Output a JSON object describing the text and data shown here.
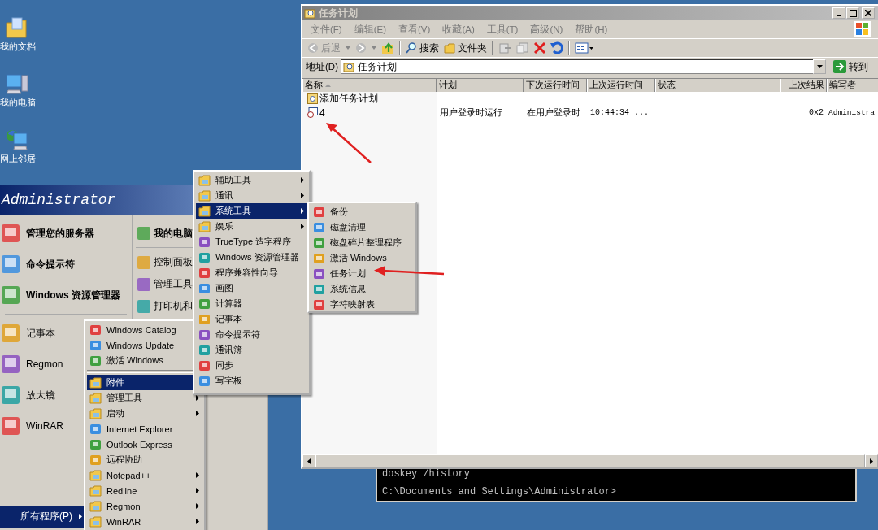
{
  "desktop_icons": [
    {
      "label": "我的文档",
      "kind": "documents"
    },
    {
      "label": "我的电脑",
      "kind": "computer"
    },
    {
      "label": "网上邻居",
      "kind": "network"
    }
  ],
  "explorer": {
    "title": "任务计划",
    "menu": [
      "文件(F)",
      "编辑(E)",
      "查看(V)",
      "收藏(A)",
      "工具(T)",
      "高级(N)",
      "帮助(H)"
    ],
    "toolbar": {
      "back": "后退",
      "search": "搜索",
      "folders": "文件夹"
    },
    "address": {
      "label": "地址(D)",
      "value": "任务计划",
      "go": "转到"
    },
    "columns": [
      {
        "label": "名称",
        "sorted": true
      },
      {
        "label": "计划",
        "sorted": false
      },
      {
        "label": "下次运行时间",
        "sorted": false
      },
      {
        "label": "上次运行时间",
        "sorted": false
      },
      {
        "label": "状态",
        "sorted": false
      },
      {
        "label": "上次结果",
        "sorted": false
      },
      {
        "label": "编写者",
        "sorted": false
      }
    ],
    "rows": [
      {
        "kind": "add",
        "cells": [
          "添加任务计划"
        ]
      },
      {
        "kind": "task",
        "cells": [
          "4",
          "用户登录时运行",
          "在用户登录时",
          "10:44:34 ...",
          null,
          "0x2",
          "Administra"
        ]
      }
    ]
  },
  "console": {
    "lines": [
      "doskey /history",
      "C:\\Documents and Settings\\Administrator>"
    ]
  },
  "start_menu": {
    "user": "Administrator",
    "pinned_items": [
      "管理您的服务器",
      "命令提示符",
      "Windows 资源管理器"
    ],
    "recent_items": [
      "记事本",
      "Regmon",
      "放大镜",
      "WinRAR"
    ],
    "right_items": [
      {
        "label": "我的电脑",
        "bold": true
      },
      {
        "label": "控制面板",
        "bold": false
      },
      {
        "label": "管理工具",
        "bold": false
      },
      {
        "label": "打印机和",
        "bold": false
      }
    ],
    "all_programs": {
      "label": "所有程序(P)",
      "selected": true
    }
  },
  "programs_menu": [
    {
      "label": "Windows Catalog",
      "kind": "program",
      "submenu": false,
      "selected": false
    },
    {
      "label": "Windows Update",
      "kind": "program",
      "submenu": false,
      "selected": false
    },
    {
      "label": "激活 Windows",
      "kind": "program",
      "submenu": false,
      "selected": false
    },
    {
      "kind": "separator"
    },
    {
      "label": "附件",
      "kind": "folder",
      "submenu": true,
      "selected": true
    },
    {
      "label": "管理工具",
      "kind": "folder",
      "submenu": true,
      "selected": false
    },
    {
      "label": "启动",
      "kind": "folder",
      "submenu": true,
      "selected": false
    },
    {
      "label": "Internet Explorer",
      "kind": "program",
      "submenu": false,
      "selected": false
    },
    {
      "label": "Outlook Express",
      "kind": "program",
      "submenu": false,
      "selected": false
    },
    {
      "label": "远程协助",
      "kind": "program",
      "submenu": false,
      "selected": false
    },
    {
      "label": "Notepad++",
      "kind": "folder",
      "submenu": true,
      "selected": false
    },
    {
      "label": "Redline",
      "kind": "folder",
      "submenu": true,
      "selected": false
    },
    {
      "label": "Regmon",
      "kind": "folder",
      "submenu": true,
      "selected": false
    },
    {
      "label": "WinRAR",
      "kind": "folder",
      "submenu": true,
      "selected": false
    }
  ],
  "accessories_menu": [
    {
      "label": "辅助工具",
      "kind": "folder",
      "submenu": true,
      "selected": false
    },
    {
      "label": "通讯",
      "kind": "folder",
      "submenu": true,
      "selected": false
    },
    {
      "label": "系统工具",
      "kind": "folder",
      "submenu": true,
      "selected": true
    },
    {
      "label": "娱乐",
      "kind": "folder",
      "submenu": true,
      "selected": false
    },
    {
      "label": "TrueType 造字程序",
      "kind": "program",
      "submenu": false,
      "selected": false
    },
    {
      "label": "Windows 资源管理器",
      "kind": "program",
      "submenu": false,
      "selected": false
    },
    {
      "label": "程序兼容性向导",
      "kind": "program",
      "submenu": false,
      "selected": false
    },
    {
      "label": "画图",
      "kind": "program",
      "submenu": false,
      "selected": false
    },
    {
      "label": "计算器",
      "kind": "program",
      "submenu": false,
      "selected": false
    },
    {
      "label": "记事本",
      "kind": "program",
      "submenu": false,
      "selected": false
    },
    {
      "label": "命令提示符",
      "kind": "program",
      "submenu": false,
      "selected": false
    },
    {
      "label": "通讯簿",
      "kind": "program",
      "submenu": false,
      "selected": false
    },
    {
      "label": "同步",
      "kind": "program",
      "submenu": false,
      "selected": false
    },
    {
      "label": "写字板",
      "kind": "program",
      "submenu": false,
      "selected": false
    }
  ],
  "system_tools_menu": [
    {
      "label": "备份",
      "kind": "program",
      "submenu": false,
      "selected": false
    },
    {
      "label": "磁盘清理",
      "kind": "program",
      "submenu": false,
      "selected": false
    },
    {
      "label": "磁盘碎片整理程序",
      "kind": "program",
      "submenu": false,
      "selected": false
    },
    {
      "label": "激活 Windows",
      "kind": "program",
      "submenu": false,
      "selected": false
    },
    {
      "label": "任务计划",
      "kind": "program",
      "submenu": false,
      "selected": false
    },
    {
      "label": "系统信息",
      "kind": "program",
      "submenu": false,
      "selected": false
    },
    {
      "label": "字符映射表",
      "kind": "program",
      "submenu": false,
      "selected": false
    }
  ]
}
